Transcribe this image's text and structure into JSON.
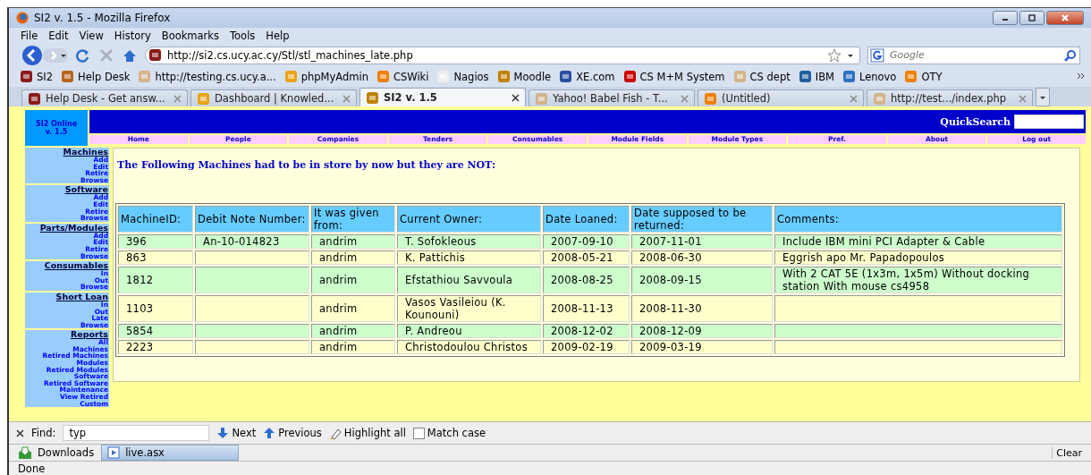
{
  "window": {
    "title": "SI2 v. 1.5 - Mozilla Firefox"
  },
  "menu": [
    "File",
    "Edit",
    "View",
    "History",
    "Bookmarks",
    "Tools",
    "Help"
  ],
  "address_bar": {
    "url": "http://si2.cs.ucy.ac.cy/Stl/stl_machines_late.php"
  },
  "search": {
    "placeholder": "Google"
  },
  "bookmarks": [
    {
      "label": "SI2"
    },
    {
      "label": "Help Desk"
    },
    {
      "label": "http://testing.cs.ucy.a..."
    },
    {
      "label": "phpMyAdmin"
    },
    {
      "label": "CSWiki"
    },
    {
      "label": "Nagios"
    },
    {
      "label": "Moodle"
    },
    {
      "label": "XE.com"
    },
    {
      "label": "CS M+M System"
    },
    {
      "label": "CS dept"
    },
    {
      "label": "IBM"
    },
    {
      "label": "Lenovo"
    },
    {
      "label": "OTY"
    }
  ],
  "tabs": [
    {
      "label": "Help Desk - Get answ...",
      "selected": false
    },
    {
      "label": "Dashboard | Knowled...",
      "selected": false
    },
    {
      "label": "SI2 v. 1.5",
      "selected": true
    },
    {
      "label": "Yahoo! Babel Fish - T...",
      "selected": false
    },
    {
      "label": "(Untitled)",
      "selected": false
    },
    {
      "label": "http://test.../index.php",
      "selected": false
    }
  ],
  "page": {
    "logo": [
      "SI2 Online",
      "v. 1.5"
    ],
    "quicksearch_label": "QuickSearch",
    "nav": [
      "Home",
      "People",
      "Companies",
      "Tenders",
      "Consumables",
      "Module Fields",
      "Module Types",
      "Pref.",
      "About",
      "Log out"
    ],
    "sidebar": [
      {
        "title": "Machines",
        "links": [
          "Add",
          "Edit",
          "Retire",
          "Browse"
        ]
      },
      {
        "title": "Software",
        "links": [
          "Add",
          "Edit",
          "Retire",
          "Browse"
        ]
      },
      {
        "title": "Parts/Modules",
        "links": [
          "Add",
          "Edit",
          "Retire",
          "Browse"
        ]
      },
      {
        "title": "Consumables",
        "links": [
          "In",
          "Out",
          "Browse"
        ]
      },
      {
        "title": "Short Loan",
        "links": [
          "In",
          "Out",
          "Late",
          "Browse"
        ]
      },
      {
        "title": "Reports",
        "links": [
          "All",
          "Machines",
          "Retired Machines",
          "Modules",
          "Retired Modules",
          "Software",
          "Retired Software",
          "Maintenance",
          "View Retired",
          "Custom"
        ]
      }
    ],
    "heading": "The Following Machines had to be in store by now but they are NOT:",
    "table": {
      "columns": [
        "MachineID:",
        "Debit Note Number:",
        "It was given from:",
        "Current Owner:",
        "Date Loaned:",
        "Date supposed to be returned:",
        "Comments:"
      ],
      "rows": [
        [
          "396",
          "An-10-014823",
          "andrim",
          "T. Sofokleous",
          "2007-09-10",
          "2007-11-01",
          "Include IBM mini PCI Adapter & Cable"
        ],
        [
          "863",
          "",
          "andrim",
          "K. Pattichis",
          "2008-05-21",
          "2008-06-30",
          "Eggrish apo Mr. Papadopoulos"
        ],
        [
          "1812",
          "",
          "andrim",
          "Efstathiou Savvoula",
          "2008-08-25",
          "2008-09-15",
          "With 2 CAT 5E (1x3m, 1x5m) Without docking station With mouse cs4958"
        ],
        [
          "1103",
          "",
          "andrim",
          "Vasos Vasileiou (K. Kounouni)",
          "2008-11-13",
          "2008-11-30",
          ""
        ],
        [
          "5854",
          "",
          "andrim",
          "P. Andreou",
          "2008-12-02",
          "2008-12-09",
          ""
        ],
        [
          "2223",
          "",
          "andrim",
          "Christodoulou Christos",
          "2009-02-19",
          "2009-03-19",
          ""
        ]
      ]
    }
  },
  "find_bar": {
    "label": "Find:",
    "value": "typ",
    "next": "Next",
    "previous": "Previous",
    "highlight": "Highlight all",
    "match_case": {
      "label": "Match case",
      "checked": false
    }
  },
  "downloads_bar": {
    "label": "Downloads",
    "file": "live.asx",
    "clear": "Clear"
  },
  "status_bar": {
    "text": "Done"
  }
}
